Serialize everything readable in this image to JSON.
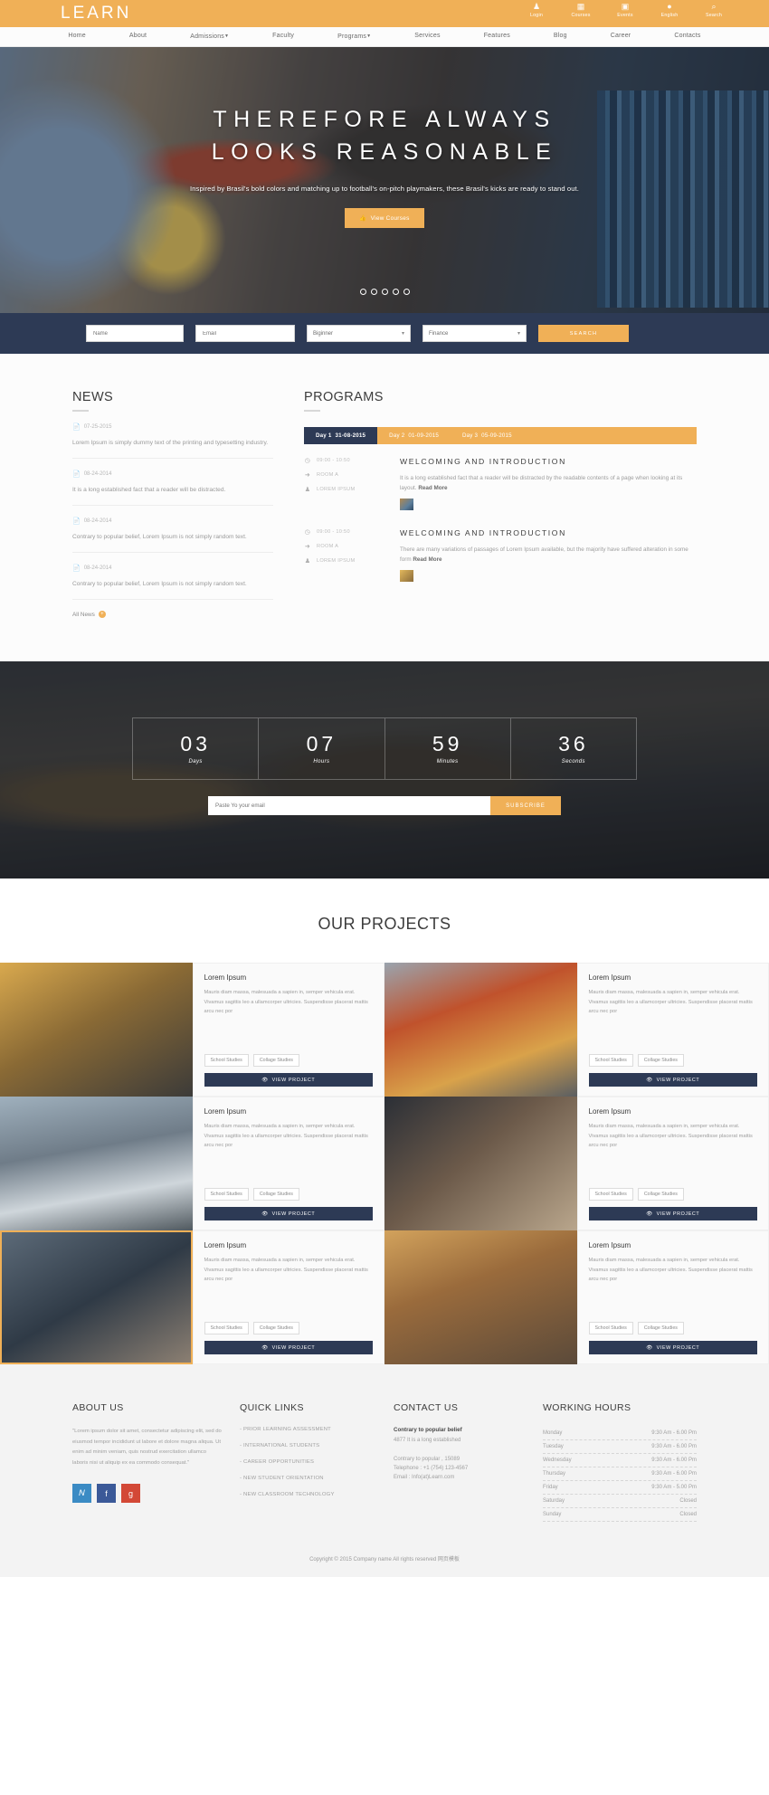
{
  "header": {
    "logo": "LEARN",
    "icons": [
      {
        "name": "login-icon",
        "glyph": "♟",
        "label": "Login"
      },
      {
        "name": "courses-icon",
        "glyph": "▦",
        "label": "Courses"
      },
      {
        "name": "events-icon",
        "glyph": "Ὄ5",
        "label": "Events"
      },
      {
        "name": "language-icon",
        "glyph": "●",
        "label": "English"
      },
      {
        "name": "search-icon",
        "glyph": "⌕",
        "label": "Search"
      }
    ]
  },
  "nav": {
    "items": [
      {
        "label": "Home",
        "caret": false
      },
      {
        "label": "About",
        "caret": false
      },
      {
        "label": "Admissions",
        "caret": true
      },
      {
        "label": "Faculty",
        "caret": false
      },
      {
        "label": "Programs",
        "caret": true
      },
      {
        "label": "Services",
        "caret": false
      },
      {
        "label": "Features",
        "caret": false
      },
      {
        "label": "Blog",
        "caret": false
      },
      {
        "label": "Career",
        "caret": false
      },
      {
        "label": "Contacts",
        "caret": false
      }
    ]
  },
  "hero": {
    "title_line1": "THEREFORE ALWAYS",
    "title_line2": "LOOKS REASONABLE",
    "subtitle": "Inspired by Brasil's bold colors and matching up to football's on-pitch playmakers, these Brasil's kicks are ready to stand out.",
    "button_label": "View Courses",
    "button_icon": "👍",
    "slide_count": 5,
    "active_slide": 0
  },
  "search_form": {
    "name_placeholder": "Name",
    "email_placeholder": "Email",
    "level_value": "Biginner",
    "subject_value": "Finance",
    "button_label": "SEARCH"
  },
  "news": {
    "title": "NEWS",
    "items": [
      {
        "date": "07-25-2015",
        "text": "Lorem Ipsum is simply dummy text of the printing and typesetting industry."
      },
      {
        "date": "08-24-2014",
        "text": "It is a long established fact that a reader will be distracted."
      },
      {
        "date": "08-24-2014",
        "text": "Contrary to popular belief, Lorem Ipsum is not simply random text."
      },
      {
        "date": "08-24-2014",
        "text": "Contrary to popular belief, Lorem Ipsum is not simply random text."
      }
    ],
    "all_news_label": "All News"
  },
  "programs": {
    "title": "PROGRAMS",
    "tabs": [
      {
        "day": "Day 1",
        "date": "31-08-2015",
        "active": true
      },
      {
        "day": "Day 2",
        "date": "01-09-2015",
        "active": false
      },
      {
        "day": "Day 3",
        "date": "05-09-2015",
        "active": false
      }
    ],
    "entries": [
      {
        "time": "09:00 - 10:50",
        "room": "ROOM A",
        "speaker": "LOREM IPSUM",
        "heading": "WELCOMING AND INTRODUCTION",
        "text": "It is a long established fact that a reader will be distracted by the readable contents of a page when looking at its layout.",
        "read_more": "Read More"
      },
      {
        "time": "09:00 - 10:50",
        "room": "ROOM A",
        "speaker": "LOREM IPSUM",
        "heading": "WELCOMING AND INTRODUCTION",
        "text": "There are many variations of passages of Lorem Ipsum available, but the majority have suffered alteration in some form",
        "read_more": "Read More"
      }
    ]
  },
  "countdown": {
    "units": [
      {
        "value": "03",
        "label": "Days"
      },
      {
        "value": "07",
        "label": "Hours"
      },
      {
        "value": "59",
        "label": "Minutes"
      },
      {
        "value": "36",
        "label": "Seconds"
      }
    ],
    "email_placeholder": "Paste Yo your email",
    "subscribe_label": "SUBSCRIBE"
  },
  "projects": {
    "title": "OUR PROJECTS",
    "cards": [
      {
        "heading": "Lorem Ipsum",
        "text": "Mauris diam massa, malesuada a sapien in, semper vehicula erat. Vivamus sagittis leo a ullamcorper ultricies. Suspendisse placerat mattis arcu nec por",
        "tags": [
          "School Studies",
          "Collage Studies"
        ],
        "button_label": "VIEW PROJECT"
      },
      {
        "heading": "Lorem Ipsum",
        "text": "Mauris diam massa, malesuada a sapien in, semper vehicula erat. Vivamus sagittis leo a ullamcorper ultricies. Suspendisse placerat mattis arcu nec por",
        "tags": [
          "School Studies",
          "Collage Studies"
        ],
        "button_label": "VIEW PROJECT"
      },
      {
        "heading": "Lorem Ipsum",
        "text": "Mauris diam massa, malesuada a sapien in, semper vehicula erat. Vivamus sagittis leo a ullamcorper ultricies. Suspendisse placerat mattis arcu nec por",
        "tags": [
          "School Studies",
          "Collage Studies"
        ],
        "button_label": "VIEW PROJECT"
      },
      {
        "heading": "Lorem Ipsum",
        "text": "Mauris diam massa, malesuada a sapien in, semper vehicula erat. Vivamus sagittis leo a ullamcorper ultricies. Suspendisse placerat mattis arcu nec por",
        "tags": [
          "School Studies",
          "Collage Studies"
        ],
        "button_label": "VIEW PROJECT"
      },
      {
        "heading": "Lorem Ipsum",
        "text": "Mauris diam massa, malesuada a sapien in, semper vehicula erat. Vivamus sagittis leo a ullamcorper ultricies. Suspendisse placerat mattis arcu nec por",
        "tags": [
          "School Studies",
          "Collage Studies"
        ],
        "button_label": "VIEW PROJECT"
      },
      {
        "heading": "Lorem Ipsum",
        "text": "Mauris diam massa, malesuada a sapien in, semper vehicula erat. Vivamus sagittis leo a ullamcorper ultricies. Suspendisse placerat mattis arcu nec por",
        "tags": [
          "School Studies",
          "Collage Studies"
        ],
        "button_label": "VIEW PROJECT"
      }
    ]
  },
  "footer": {
    "about": {
      "title": "ABOUT US",
      "text": "\"Lorem ipsum dolor sit amet, consectetur adipiscing elit, sed do eiusmod tempor incididunt ut labore et dolore magna aliqua. Ut enim ad minim veniam, quis nostrud exercitation ullamco laboris nisi ut aliquip ex ea commodo consequat.\"",
      "social": [
        {
          "name": "twitter-icon",
          "glyph": "t"
        },
        {
          "name": "facebook-icon",
          "glyph": "f"
        },
        {
          "name": "google-plus-icon",
          "glyph": "g"
        }
      ]
    },
    "quick_links": {
      "title": "QUICK LINKS",
      "items": [
        "- PRIOR LEARNING ASSESSMENT",
        "- INTERNATIONAL STUDENTS",
        "- CAREER OPPORTUNITIES",
        "- NEW STUDENT ORIENTATION",
        "- NEW CLASSROOM TECHNOLOGY"
      ]
    },
    "contact": {
      "title": "CONTACT US",
      "strong": "Contrary to popular belief",
      "address": "4877 It is a long established",
      "line1": "Contrary to popular , 15089",
      "line2": "Telephone : +1 (754) 123-4567",
      "line3": "Email : Info(at)Learn.com"
    },
    "hours": {
      "title": "WORKING HOURS",
      "rows": [
        {
          "day": "Monday",
          "time": "9:30 Am - 6.00 Pm"
        },
        {
          "day": "Tuesday",
          "time": "9:30 Am - 6.00 Pm"
        },
        {
          "day": "Wednesday",
          "time": "9:30 Am - 6.00 Pm"
        },
        {
          "day": "Thursday",
          "time": "9:30 Am - 6.00 Pm"
        },
        {
          "day": "Friday",
          "time": "9:30 Am - 5.00 Pm"
        },
        {
          "day": "Saturday",
          "time": "Closed"
        },
        {
          "day": "Sunday",
          "time": "Closed"
        }
      ]
    },
    "copyright": "Copyright © 2015 Company name All rights reserved 网页模板"
  },
  "colors": {
    "accent": "#f0b057",
    "dark": "#2d3a55"
  }
}
